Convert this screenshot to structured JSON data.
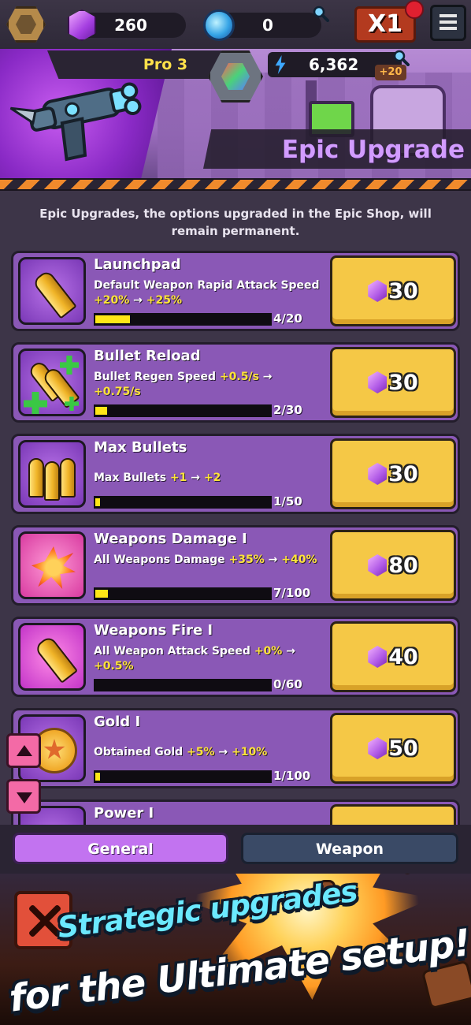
{
  "topbar": {
    "gems": "260",
    "orbs": "0",
    "speed_label": "X1"
  },
  "header": {
    "rank_label": "Pro 3",
    "energy": "6,362",
    "energy_bonus": "+20",
    "title": "Epic Upgrade"
  },
  "description": "Epic Upgrades, the options upgraded in the Epic Shop, will remain permanent.",
  "upgrades": [
    {
      "name": "Launchpad",
      "detail_prefix": "Default Weapon Rapid Attack Speed",
      "from": "+20%",
      "arrow": "→",
      "to": "+25%",
      "level": "4/20",
      "progress": 0.2,
      "price": "30",
      "icon": "bullet-icon"
    },
    {
      "name": "Bullet Reload",
      "detail_prefix": "Bullet Regen Speed",
      "from": "+0.5/s",
      "arrow": "→",
      "to": "+0.75/s",
      "level": "2/30",
      "progress": 0.067,
      "price": "30",
      "icon": "bullet-reload-icon"
    },
    {
      "name": "Max Bullets",
      "detail_prefix": "Max Bullets",
      "from": "+1",
      "arrow": "→",
      "to": "+2",
      "level": "1/50",
      "progress": 0.02,
      "price": "30",
      "icon": "triple-bullet-icon"
    },
    {
      "name": "Weapons Damage I",
      "detail_prefix": "All Weapons Damage",
      "from": "+35%",
      "arrow": "→",
      "to": "+40%",
      "level": "7/100",
      "progress": 0.07,
      "price": "80",
      "icon": "explosion-icon"
    },
    {
      "name": "Weapons Fire I",
      "detail_prefix": "All Weapon Attack Speed",
      "from": "+0%",
      "arrow": "→",
      "to": "+0.5%",
      "level": "0/60",
      "progress": 0,
      "price": "40",
      "icon": "fired-bullet-icon"
    },
    {
      "name": "Gold I",
      "detail_prefix": "Obtained Gold",
      "from": "+5%",
      "arrow": "→",
      "to": "+10%",
      "level": "1/100",
      "progress": 0.01,
      "price": "50",
      "icon": "gold-coin-icon"
    },
    {
      "name": "Power I",
      "icon": "power-icon"
    }
  ],
  "tabs": {
    "general": "General",
    "weapon": "Weapon"
  },
  "promo": {
    "line1": "Strategic upgrades",
    "line2": "for the Ultimate setup!"
  },
  "colors": {
    "card_bg": "#8a58b6",
    "price_button": "#f5c846",
    "highlight": "#ffe33a",
    "title": "#d29cff"
  }
}
